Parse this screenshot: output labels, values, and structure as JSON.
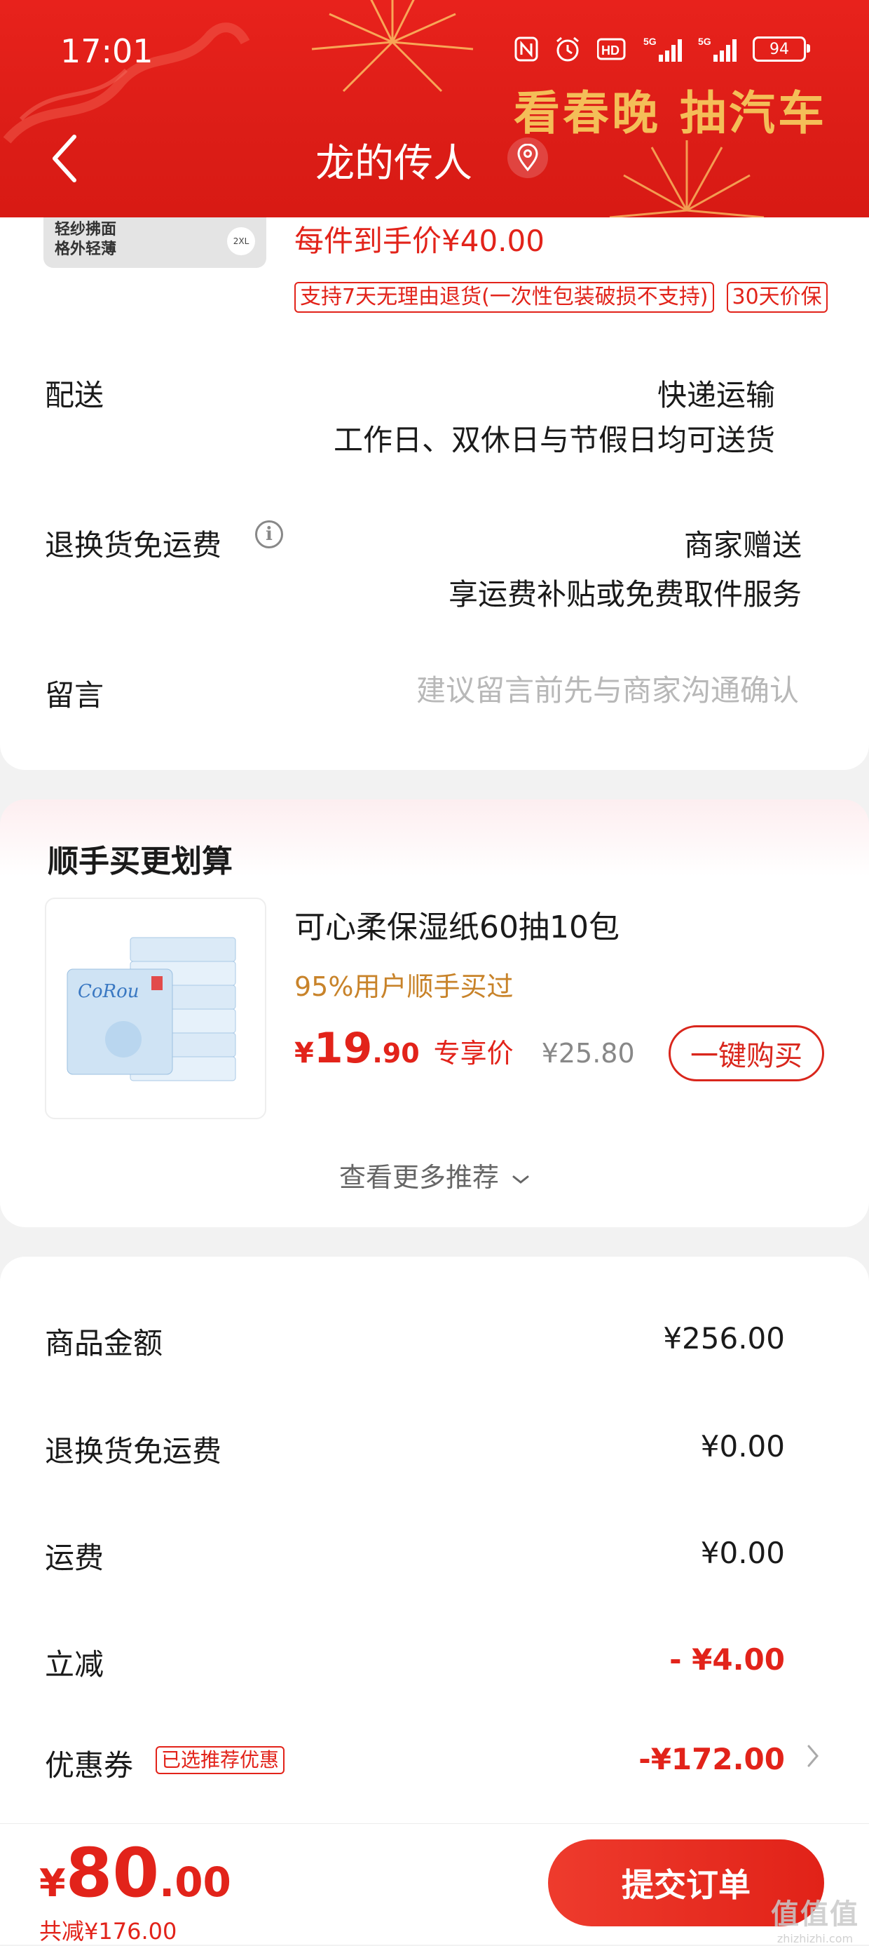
{
  "status_bar": {
    "time": "17:01",
    "net1": "5G",
    "net2": "5G",
    "hd": "HD",
    "battery": "94",
    "icons": [
      "nfc-icon",
      "alarm-icon",
      "hd-voice-icon",
      "signal-5g-icon",
      "signal-5g-icon",
      "battery-icon"
    ]
  },
  "header": {
    "promo": "看春晚 抽汽车",
    "title": "龙的传人"
  },
  "product": {
    "thumb_text_1": "轻纱拂面",
    "thumb_text_2": "格外轻薄",
    "thumb_size": "2XL",
    "unit_price": "每件到手价¥40.00",
    "tags": [
      "支持7天无理由退货(一次性包装破损不支持)",
      "30天价保"
    ]
  },
  "delivery": {
    "label": "配送",
    "method": "快递运输",
    "schedule": "工作日、双休日与节假日均可送货"
  },
  "return_shipping": {
    "label": "退换货免运费",
    "value_1": "商家赠送",
    "value_2": "享运费补贴或免费取件服务"
  },
  "message": {
    "label": "留言",
    "placeholder": "建议留言前先与商家沟通确认"
  },
  "recommend": {
    "title": "顺手买更划算",
    "item_name": "可心柔保湿纸60抽10包",
    "sold_text": "95%用户顺手买过",
    "price_yen": "¥",
    "price_int": "19",
    "price_dec": ".90",
    "exclusive": "专享价",
    "orig_price": "¥25.80",
    "buy_label": "一键购买",
    "more_label": "查看更多推荐"
  },
  "amounts": {
    "rows": [
      {
        "label": "商品金额",
        "value": "¥256.00"
      },
      {
        "label": "退换货免运费",
        "value": "¥0.00"
      },
      {
        "label": "运费",
        "value": "¥0.00"
      },
      {
        "label": "立减",
        "value": "- ¥4.00"
      },
      {
        "label": "优惠券",
        "value": "-¥172.00"
      }
    ],
    "coupon_badge": "已选推荐优惠"
  },
  "footer": {
    "total_yen": "¥",
    "total_int": "80",
    "total_dec": ".00",
    "saved": "共减¥176.00",
    "submit": "提交订单",
    "watermark": "值值值",
    "watermark_small": "zhizhizhi.com"
  },
  "colors": {
    "brand_red": "#e2231a",
    "header_red": "#dc1d17",
    "gold": "#f6c75c",
    "sold_orange": "#c8832a"
  }
}
